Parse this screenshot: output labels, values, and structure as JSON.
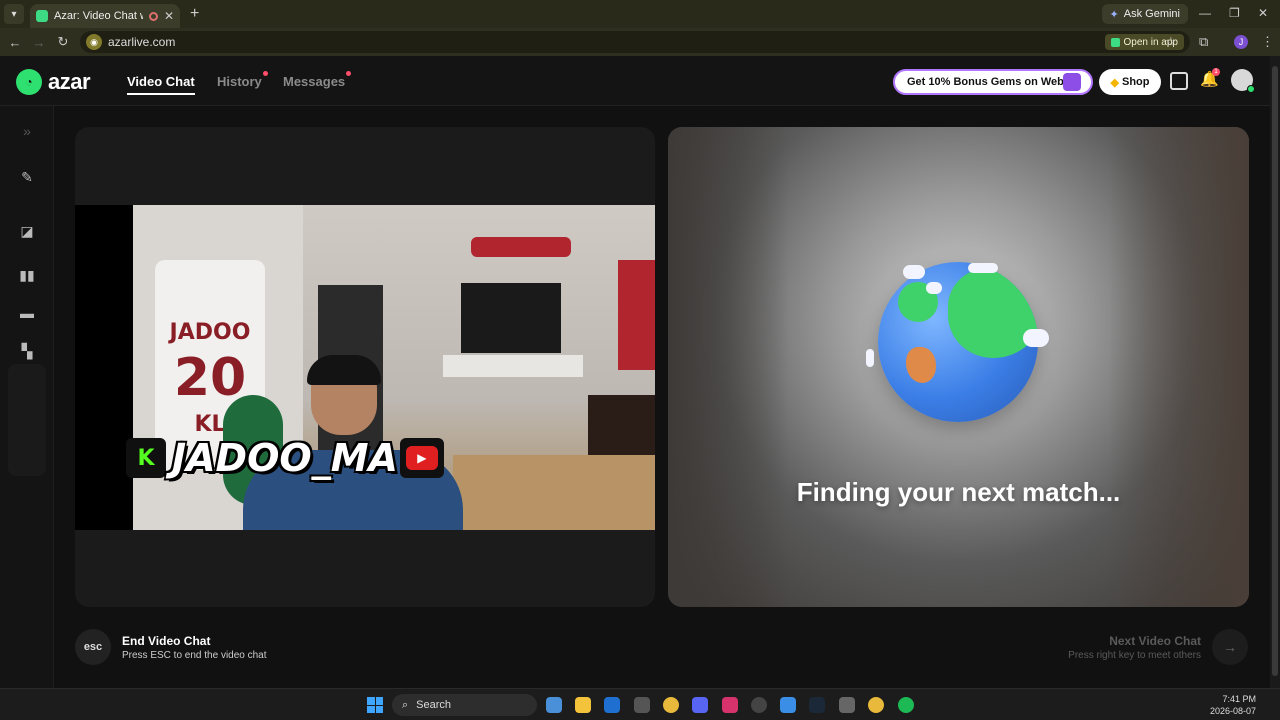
{
  "browser": {
    "tab_title": "Azar: Video Chat with New",
    "new_tab": "+",
    "ask_gemini": "Ask Gemini",
    "url": "azarlive.com",
    "open_in_app": "Open in app",
    "profile_initial": "J"
  },
  "header": {
    "logo_text": "azar",
    "nav": [
      "Video Chat",
      "History",
      "Messages"
    ],
    "promo": "Get 10% Bonus Gems on Web!",
    "shop": "Shop",
    "notification_count": "1"
  },
  "left_panel": {
    "jersey_name": "JADOO",
    "jersey_number": "20",
    "jersey_initials": "KL",
    "kick_logo": "K",
    "streamer_handle": "JADOO_MA"
  },
  "right_panel": {
    "status": "Finding your next match..."
  },
  "controls": {
    "esc_key": "esc",
    "end_title": "End Video Chat",
    "end_sub": "Press ESC to end the video chat",
    "next_title": "Next Video Chat",
    "next_sub": "Press right key to meet others"
  },
  "taskbar": {
    "search": "Search",
    "time": "7:41 PM",
    "date": "2026-08-07"
  },
  "colors": {
    "brand_green": "#2ee06f",
    "notification_red": "#ff4d6a",
    "promo_border": "#b277ff"
  }
}
